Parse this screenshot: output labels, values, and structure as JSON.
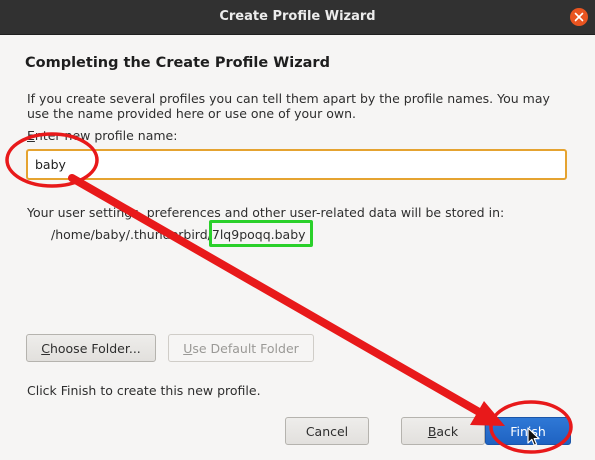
{
  "window": {
    "title": "Create Profile Wizard"
  },
  "wizard": {
    "heading": "Completing the Create Profile Wizard",
    "description": "If you create several profiles you can tell them apart by the profile names. You may use the name provided here or use one of your own.",
    "name_label_mnemonic": "E",
    "name_label_rest": "nter new profile name:",
    "name_value": "baby",
    "storage_text": "Your user settings, preferences and other user-related data will be stored in:",
    "storage_path": "/home/baby/.thunderbird/7lq9poqq.baby",
    "choose_folder_mnemonic": "C",
    "choose_folder_rest": "hoose Folder...",
    "use_default_mnemonic": "U",
    "use_default_rest": "se Default Folder",
    "finish_note": "Click Finish to create this new profile."
  },
  "footer": {
    "cancel_label": "Cancel",
    "back_mnemonic": "B",
    "back_rest": "ack",
    "finish_label": "Finish"
  },
  "colors": {
    "titlebar": "#313131",
    "close_button": "#e95420",
    "input_focus_border": "#e5a330",
    "primary_button": "#1f63c2",
    "annotation_red": "#e8191a",
    "annotation_green": "#2ad02a"
  },
  "icons": {
    "close": "close-icon",
    "cursor": "mouse-pointer-icon"
  }
}
